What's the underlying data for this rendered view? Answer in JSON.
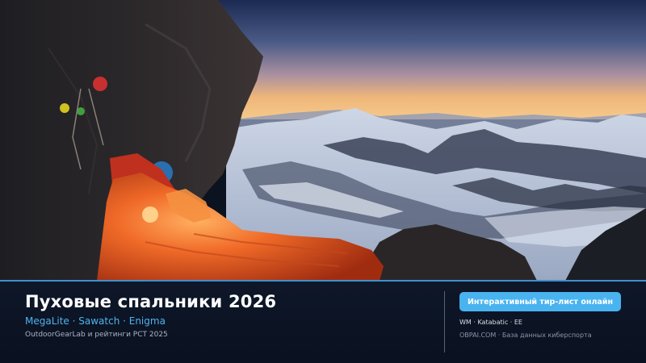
{
  "banner": {
    "title": "Пуховые спальники 2026",
    "models": "MegaLite · Sawatch · Enigma",
    "source": "OutdoorGearLab и рейтинги PCT 2025",
    "cta_label": "Интерактивный тир-лист онлайн",
    "brands": "WM · Katabatic · EE",
    "site": "OBPAI.COM · База данных киберспорта"
  },
  "colors": {
    "accent": "#49b3f0",
    "footer_bg": "#0b1220",
    "divider": "#3f8fcf",
    "sleeping_bag": "#e8471e"
  },
  "icons": {
    "hero": "mountain-bivouac-photo"
  }
}
